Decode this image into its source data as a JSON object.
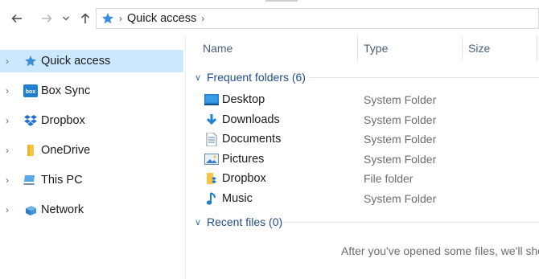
{
  "navigation": {
    "back_icon": "arrow-left-icon",
    "forward_icon": "arrow-right-icon",
    "recent_icon": "chevron-down-icon",
    "up_icon": "arrow-up-icon"
  },
  "address_bar": {
    "location_icon": "star-icon",
    "crumbs": [
      "Quick access"
    ]
  },
  "sidebar": {
    "items": [
      {
        "label": "Quick access",
        "icon": "star-icon",
        "selected": true
      },
      {
        "label": "Box Sync",
        "icon": "box-icon"
      },
      {
        "label": "Dropbox",
        "icon": "dropbox-icon"
      },
      {
        "label": "OneDrive",
        "icon": "folder-icon"
      },
      {
        "label": "This PC",
        "icon": "computer-icon"
      },
      {
        "label": "Network",
        "icon": "network-icon"
      }
    ]
  },
  "columns": {
    "name": "Name",
    "type": "Type",
    "size": "Size"
  },
  "groups": {
    "frequent": {
      "label": "Frequent folders (6)"
    },
    "recent": {
      "label": "Recent files (0)"
    }
  },
  "frequent_folders": [
    {
      "name": "Desktop",
      "type": "System Folder",
      "icon": "desktop-icon"
    },
    {
      "name": "Downloads",
      "type": "System Folder",
      "icon": "download-icon"
    },
    {
      "name": "Documents",
      "type": "System Folder",
      "icon": "document-icon"
    },
    {
      "name": "Pictures",
      "type": "System Folder",
      "icon": "pictures-icon"
    },
    {
      "name": "Dropbox",
      "type": "File folder",
      "icon": "dropbox-folder-icon"
    },
    {
      "name": "Music",
      "type": "System Folder",
      "icon": "music-icon"
    }
  ],
  "empty_message": "After you've opened some files, we'll sho",
  "colors": {
    "selected_bg": "#cce8ff",
    "group_label": "#1f4e8c",
    "accent_blue": "#2b7cd3"
  }
}
